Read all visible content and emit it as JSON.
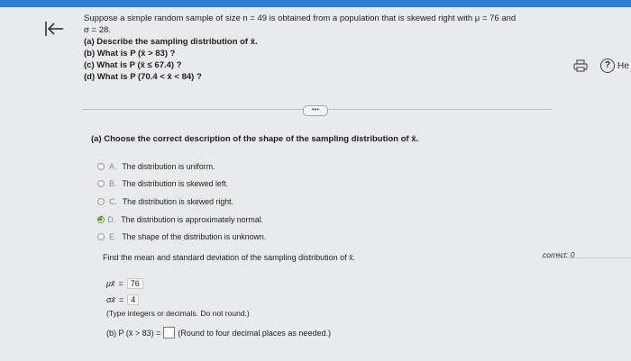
{
  "problem": {
    "line1": "Suppose a simple random sample of size n = 49 is obtained from a population that is skewed right with μ = 76 and",
    "line2": "σ = 28.",
    "part_a": "(a) Describe the sampling distribution of x̄.",
    "part_b": "(b) What is P (x̄ > 83) ?",
    "part_c": "(c) What is P (x̄ ≤ 67.4) ?",
    "part_d": "(d) What is P (70.4 < x̄ < 84) ?"
  },
  "question_a": "(a) Choose the correct description of the shape of the sampling distribution of x̄.",
  "options": [
    {
      "letter": "A.",
      "text": "The distribution is uniform."
    },
    {
      "letter": "B.",
      "text": "The distribution is skewed left."
    },
    {
      "letter": "C.",
      "text": "The distribution is skewed right."
    },
    {
      "letter": "D.",
      "text": "The distribution is approximately normal."
    },
    {
      "letter": "E.",
      "text": "The shape of the distribution is unknown."
    }
  ],
  "selected_option": "D",
  "find_text": "Find the mean and standard deviation of the sampling distribution of x̄.",
  "mean": {
    "symbol": "μx̄",
    "eq": "=",
    "value": "76"
  },
  "sd": {
    "symbol": "σx̄",
    "eq": "=",
    "value": "4"
  },
  "hint": "(Type integers or decimals. Do not round.)",
  "part_b_question": {
    "prefix": "(b) P (x̄ > 83) =",
    "suffix": "(Round to four decimal places as needed.)"
  },
  "sidebar": {
    "correct_label": "correct: 0",
    "help_label": "He"
  },
  "icons": {
    "back": "back-arrow-icon",
    "print": "print-icon",
    "help": "help-icon",
    "more": "ellipsis-icon"
  },
  "colors": {
    "accent": "#2f7fd0",
    "check": "#5c8f2e"
  }
}
